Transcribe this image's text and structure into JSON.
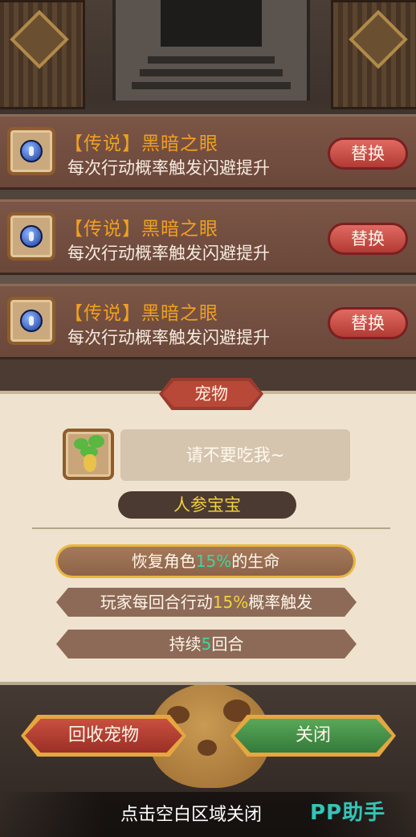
{
  "skills": [
    {
      "rarity": "【传说】",
      "name": "黑暗之眼",
      "desc": "每次行动概率触发闪避提升",
      "button": "替换",
      "icon": "blue-orb-icon"
    },
    {
      "rarity": "【传说】",
      "name": "黑暗之眼",
      "desc": "每次行动概率触发闪避提升",
      "button": "替换",
      "icon": "blue-orb-icon"
    },
    {
      "rarity": "【传说】",
      "name": "黑暗之眼",
      "desc": "每次行动概率触发闪避提升",
      "button": "替换",
      "icon": "blue-orb-icon"
    }
  ],
  "pet_panel": {
    "tab_title": "宠物",
    "pet_icon": "ginseng-sprout-icon",
    "speech": "请不要吃我~",
    "pet_name": "人参宝宝",
    "effects": [
      {
        "pre": "恢复角色",
        "highlight": "15%",
        "post": "的生命"
      },
      {
        "pre": "玩家每回合行动",
        "highlight": "15%",
        "post": "概率触发"
      },
      {
        "pre": "持续",
        "highlight": "5",
        "post": "回合"
      }
    ]
  },
  "buttons": {
    "recycle": "回收宠物",
    "close": "关闭"
  },
  "footer": {
    "hint": "点击空白区域关闭",
    "watermark": "PP助手"
  },
  "colors": {
    "rarity_orange": "#f0a020",
    "highlight_green": "#3ad6a0",
    "highlight_yellow": "#f2d33a",
    "replace_red": "#c8483f",
    "close_green": "#4a9a4c"
  }
}
